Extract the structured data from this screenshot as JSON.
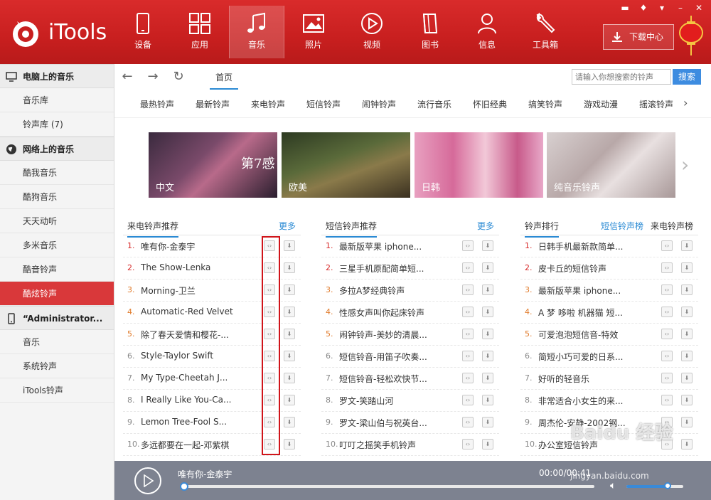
{
  "app": {
    "name": "iTools"
  },
  "nav": [
    {
      "label": "设备",
      "icon": "phone-icon"
    },
    {
      "label": "应用",
      "icon": "apps-grid-icon"
    },
    {
      "label": "音乐",
      "icon": "music-note-icon",
      "active": true
    },
    {
      "label": "照片",
      "icon": "photo-icon"
    },
    {
      "label": "视频",
      "icon": "video-play-icon"
    },
    {
      "label": "图书",
      "icon": "book-icon"
    },
    {
      "label": "信息",
      "icon": "user-icon"
    },
    {
      "label": "工具箱",
      "icon": "wrench-icon"
    }
  ],
  "download_center": "下载中心",
  "sidebar": {
    "sections": [
      {
        "title": "电脑上的音乐",
        "icon": "monitor-icon",
        "items": [
          "音乐库",
          "铃声库 (7)"
        ]
      },
      {
        "title": "网络上的音乐",
        "icon": "globe-icon",
        "items": [
          "酷我音乐",
          "酷狗音乐",
          "天天动听",
          "多米音乐",
          "酷音铃声",
          "酷炫铃声"
        ]
      },
      {
        "title": "“Administrator...",
        "icon": "phone-device-icon",
        "items": [
          "音乐",
          "系统铃声",
          "iTools铃声"
        ]
      }
    ],
    "active_item": "酷炫铃声"
  },
  "toolbar": {
    "home": "首页",
    "search_placeholder": "请输入你想搜索的铃声",
    "search_button": "搜索"
  },
  "categories": [
    "最热铃声",
    "最新铃声",
    "来电铃声",
    "短信铃声",
    "闹钟铃声",
    "流行音乐",
    "怀旧经典",
    "搞笑铃声",
    "游戏动漫",
    "摇滚铃声"
  ],
  "banners": [
    {
      "label": "中文",
      "overlay": "第7感"
    },
    {
      "label": "欧美"
    },
    {
      "label": "日韩"
    },
    {
      "label": "纯音乐铃声"
    }
  ],
  "columns": [
    {
      "title": "来电铃声推荐",
      "more": "更多",
      "rows": [
        "唯有你-金泰宇",
        "The Show-Lenka",
        "Morning-卫兰",
        "Automatic-Red Velvet",
        "除了春天爱情和樱花-...",
        "Style-Taylor Swift",
        "My Type-Cheetah J...",
        "I Really Like You-Ca...",
        "Lemon Tree-Fool S...",
        "多远都要在一起-邓紫棋"
      ]
    },
    {
      "title": "短信铃声推荐",
      "more": "更多",
      "rows": [
        "最新版苹果 iphone...",
        "三星手机原配简单短...",
        "多拉A梦经典铃声",
        "性感女声叫你起床铃声",
        "闹钟铃声-美妙的清晨...",
        "短信铃音-用笛子吹奏...",
        "短信铃音-轻松欢快节...",
        "罗文-笑踏山河",
        "罗文-梁山伯与祝英台...",
        "叮叮之摇笑手机铃声"
      ]
    },
    {
      "title": "铃声排行",
      "tab_active": "短信铃声榜",
      "tab_other": "来电铃声榜",
      "rows": [
        "日韩手机最新款简单...",
        "皮卡丘的短信铃声",
        "最新版苹果 iphone...",
        "A 梦 哆啦 机器猫 短...",
        "可爱泡泡短信音-特效",
        "简短小巧可爱的日系...",
        "好听的轻音乐",
        "非常适合小女生的来...",
        "周杰伦-安静-2002钢...",
        "办公室短信铃声"
      ]
    }
  ],
  "player": {
    "title": "唯有你-金泰宇",
    "time": "00:00/00:41",
    "progress": 0,
    "volume": 0.72
  },
  "watermark": {
    "text": "Baidu 经验",
    "url": "jingyan.baidu.com"
  },
  "colors": {
    "brand_red": "#c81f1f",
    "accent_blue": "#2a8ad4",
    "active_item": "#d9383a",
    "highlight_box": "#d0141a"
  }
}
